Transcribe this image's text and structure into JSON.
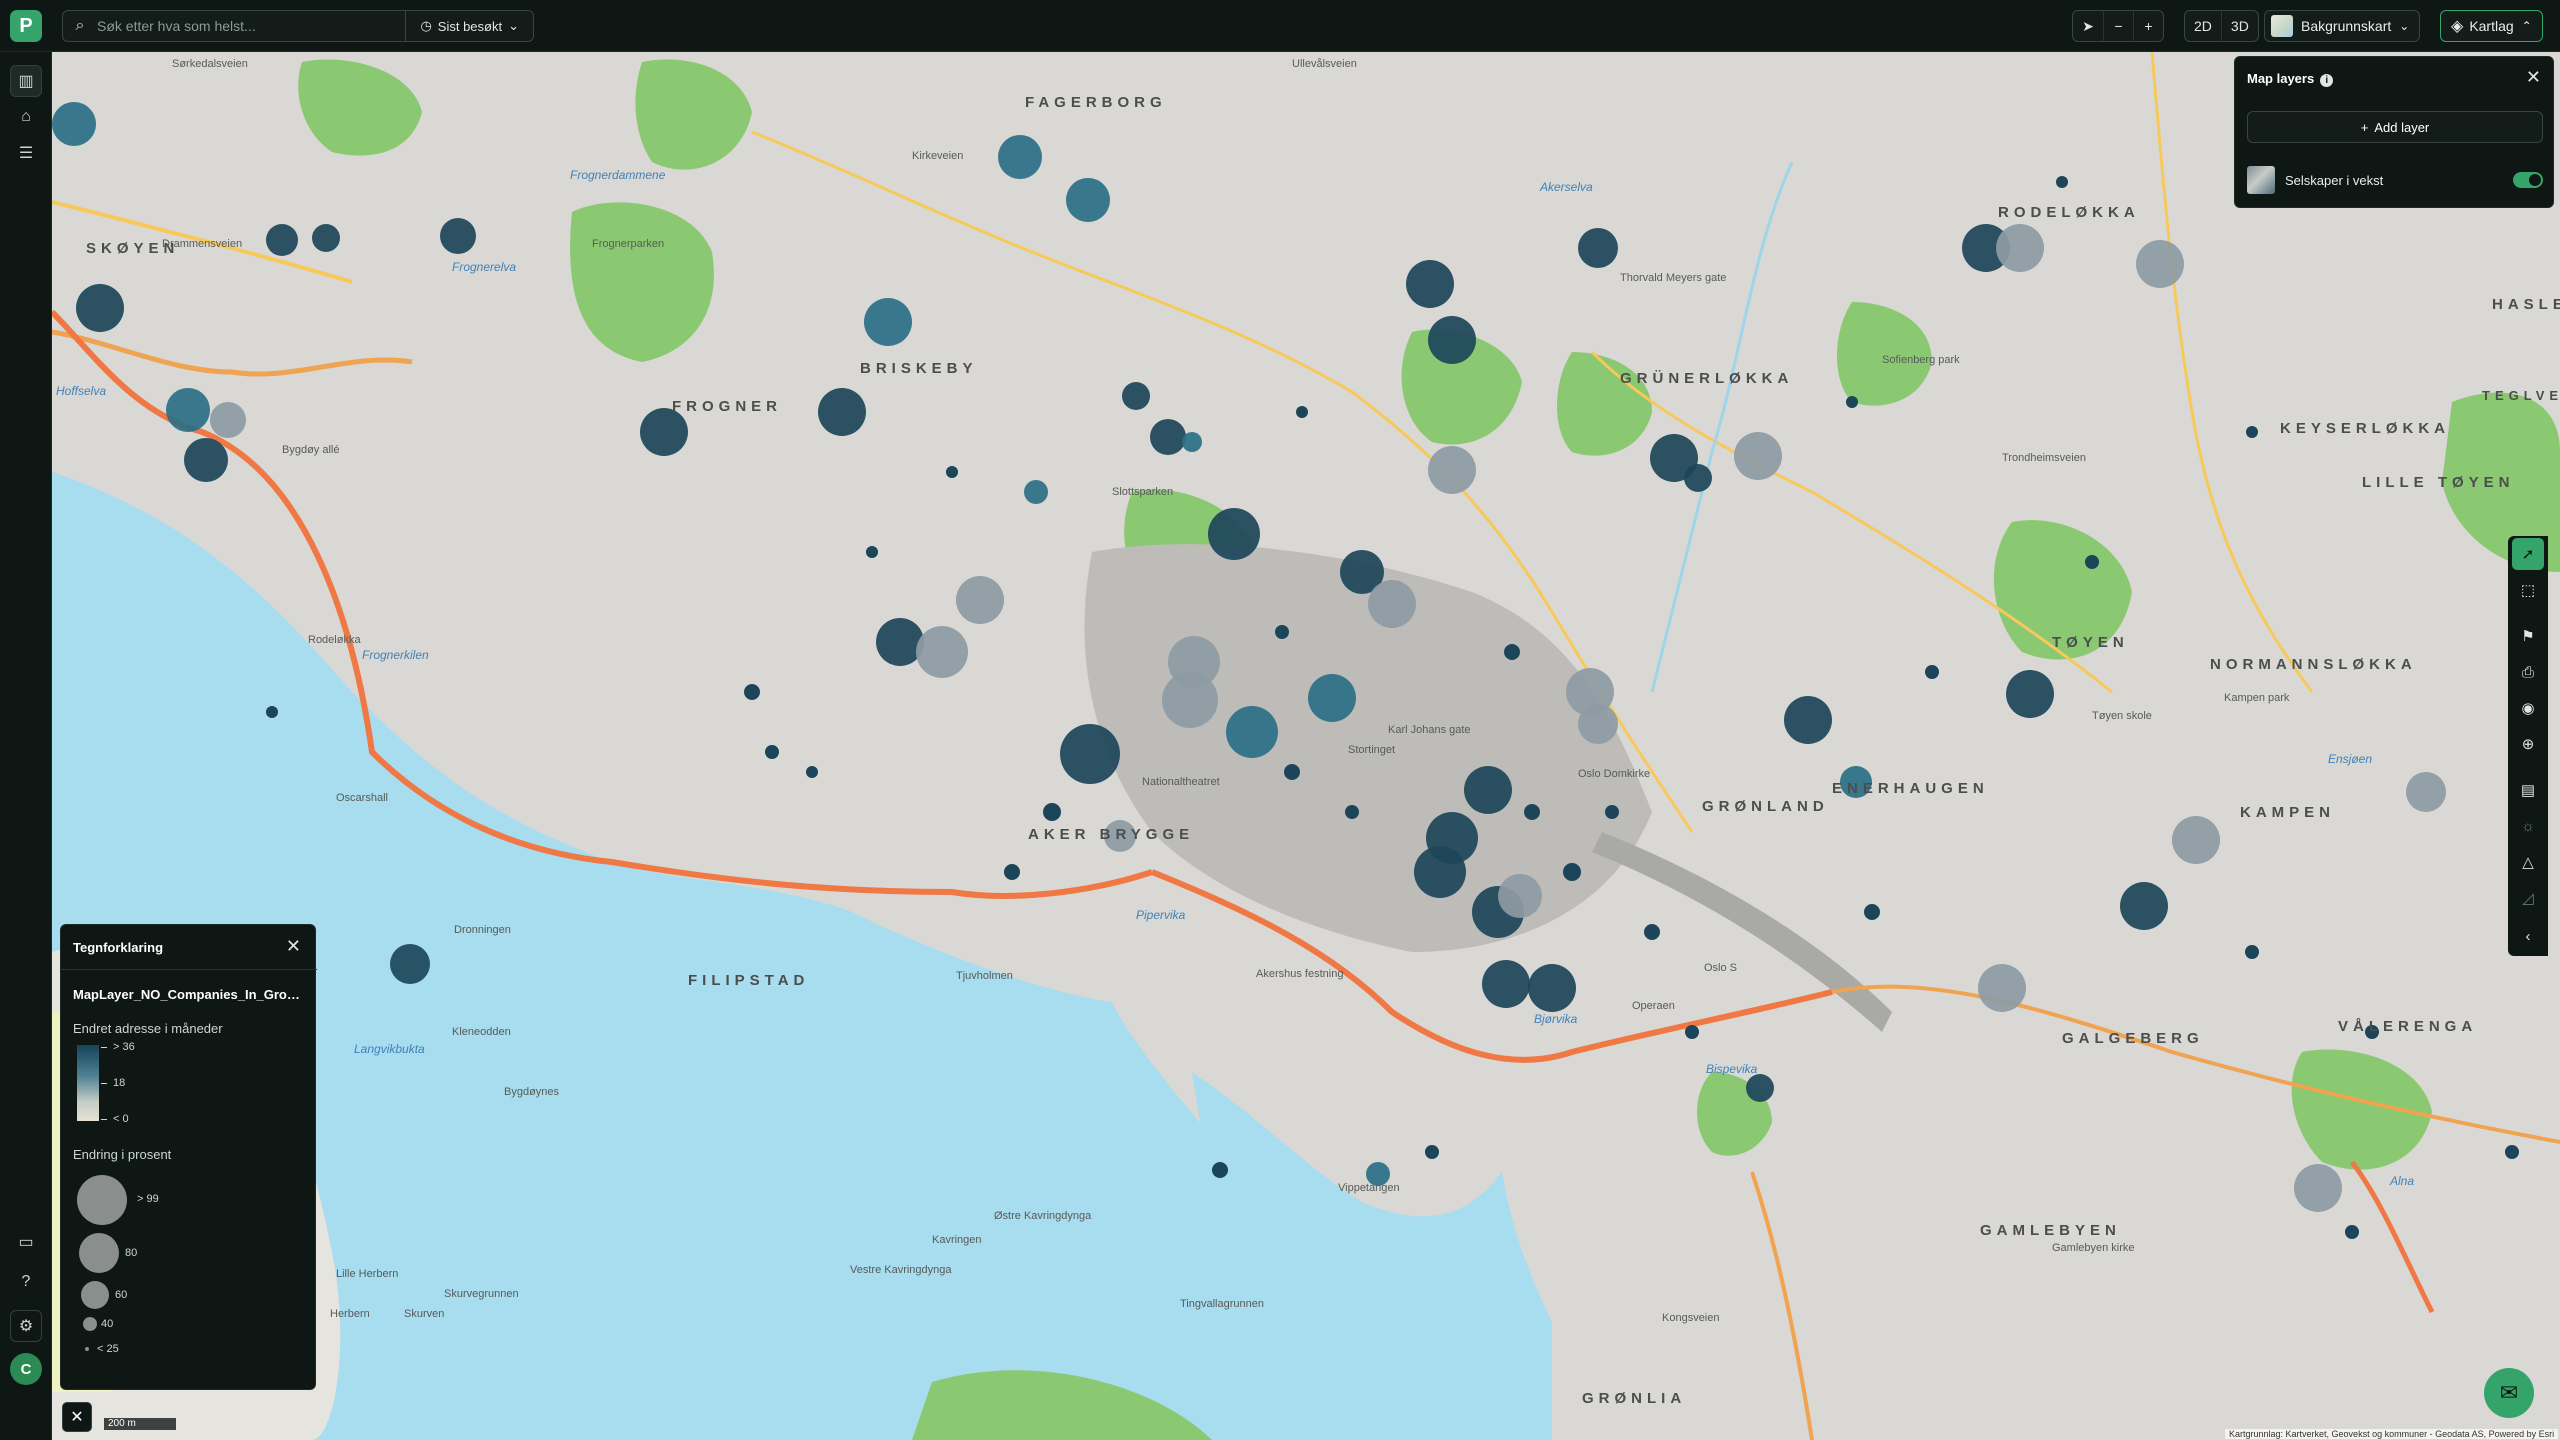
{
  "app": {
    "logo_letter": "P"
  },
  "search": {
    "placeholder": "Søk etter hva som helst...",
    "recent_label": "Sist besøkt"
  },
  "toolbar": {
    "north_icon": "compass-north-icon",
    "zoom_out": "−",
    "zoom_in": "+",
    "view_2d": "2D",
    "view_3d": "3D",
    "basemap_label": "Bakgrunnskart",
    "layers_label": "Kartlag"
  },
  "sidebar": {
    "items": [
      {
        "icon": "map-icon",
        "active": true
      },
      {
        "icon": "tag-icon",
        "active": false
      },
      {
        "icon": "list-icon",
        "active": false
      }
    ],
    "bottom": [
      {
        "icon": "feedback-icon"
      },
      {
        "icon": "help-icon"
      },
      {
        "icon": "settings-icon"
      }
    ],
    "avatar_letter": "C"
  },
  "map_layers_panel": {
    "title": "Map layers",
    "add_label": "Add layer",
    "layers": [
      {
        "name": "Selskaper i vekst",
        "enabled": true
      }
    ]
  },
  "legend": {
    "title": "Tegnforklaring",
    "layer_name": "MapLayer_NO_Companies_In_Growth",
    "color_title": "Endret adresse i måneder",
    "color_stops": [
      "> 36",
      "18",
      "< 0"
    ],
    "size_title": "Endring i prosent",
    "size_stops": [
      "> 99",
      "80",
      "60",
      "40",
      "< 25"
    ]
  },
  "scale": {
    "label": "200 m"
  },
  "attribution": "Kartgrunnlag: Kartverket, Geovekst og kommuner - Geodata AS, Powered by Esri",
  "map_labels": {
    "districts": [
      "FAGERBORG",
      "SKØYEN",
      "BRISKEBY",
      "FROGNER",
      "GRÜNERLØKKA",
      "RODELØKKA",
      "HASLE",
      "KEYSERLØKKA",
      "LILLE TØYEN",
      "TØYEN",
      "NORMANNSLØKKA",
      "ENERHAUGEN",
      "GRØNLAND",
      "KAMPEN",
      "AKER BRYGGE",
      "FILIPSTAD",
      "GALGEBERG",
      "VÅLERENGA",
      "GAMLEBYEN",
      "GRØNLIA",
      "TEGLVERKSDAMMEN"
    ],
    "streets": [
      "Sørkedalsveien",
      "Bygdøy allé",
      "Drammensveien",
      "Kirkeveien",
      "Ullevålsveien",
      "Trondheimsveien",
      "Thorvald Meyers gate",
      "Frognerparken",
      "Slottsparken",
      "Karl Johans gate",
      "Akershus festning",
      "Oslo S",
      "Operaen",
      "Kongsveien",
      "Vippetangen",
      "Kavringen",
      "Østre Kavringdynga",
      "Vestre Kavringdynga",
      "Tingvallagrunnen",
      "Skurvegrunnen",
      "Lille Herbern",
      "Herbern",
      "Skurven",
      "Kleneodden",
      "Bygdøynes",
      "Oscarshall",
      "Dronningen",
      "Rodeløkka",
      "Tjuvholmen",
      "Nationaltheatret",
      "Stortinget",
      "Oslo Domkirke",
      "Sofienberg park",
      "Kampen park",
      "Tøyen skole",
      "Gamlebyen kirke"
    ],
    "water": [
      "Frognerkilen",
      "Pipervika",
      "Bjørvika",
      "Akerselva",
      "Langvikbukta",
      "Frognerelva",
      "Alna",
      "Hoffselva",
      "Frognerdammene",
      "Ensjøen",
      "Bispevika"
    ]
  },
  "colors": {
    "accent_green": "#35a46b",
    "bubble_dark": "#1d4559",
    "bubble_mid": "#2b6f86",
    "bubble_light": "#8e9ba3",
    "water": "#a8dcef",
    "park": "#8bc872"
  }
}
